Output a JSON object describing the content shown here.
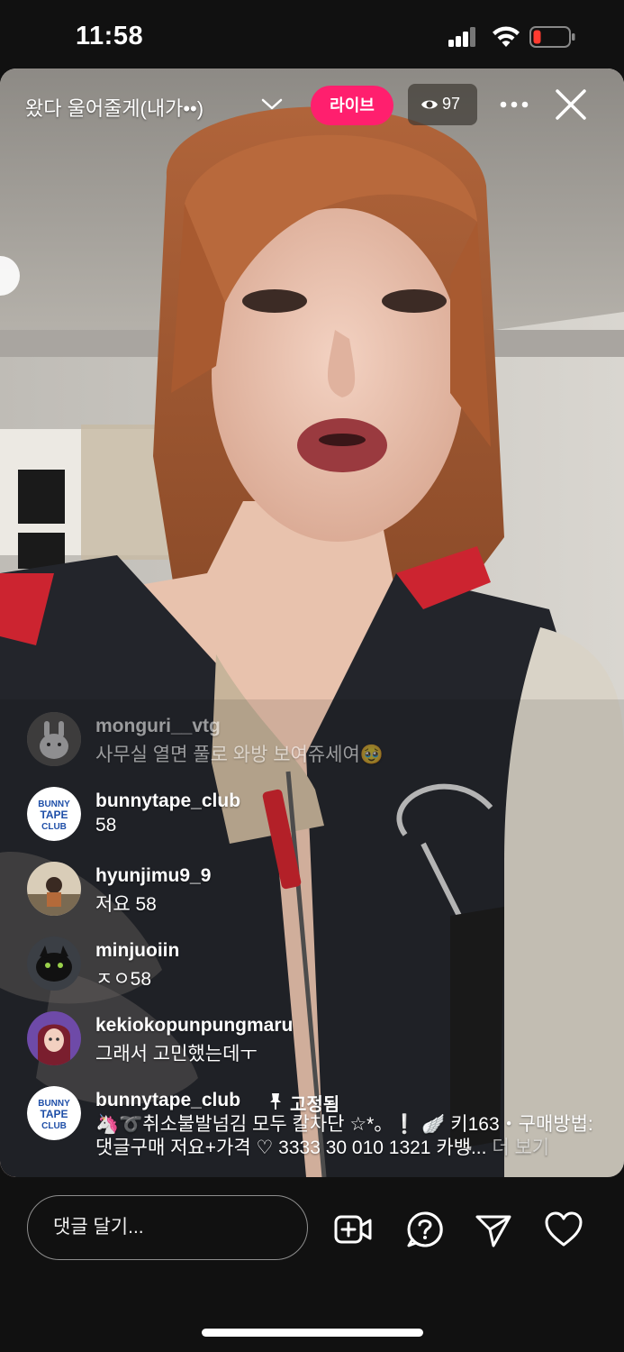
{
  "status_bar": {
    "time": "11:58"
  },
  "live": {
    "title": "왔다 울어줄게(내가••)",
    "badge": "라이브",
    "viewers": "97",
    "accent_color": "#ff1f6e"
  },
  "comments": [
    {
      "username": "monguri__vtg",
      "text": "사무실 열면 풀로 와방 보여쥬세여🥹"
    },
    {
      "username": "bunnytape_club",
      "text": "58"
    },
    {
      "username": "hyunjimu9_9",
      "text": "저요 58"
    },
    {
      "username": "minjuoiin",
      "text": "ㅈㅇ58"
    },
    {
      "username": "kekiokopunpungmaru",
      "text": "그래서 고민했는데ㅜ"
    }
  ],
  "pinned_comment": {
    "username": "bunnytape_club",
    "pin_label": "고정됨",
    "text": "🦄➰취소불발넘김 모두 칼차단 ☆*。❕ 🪽 키163・구매방법: 댓글구매 저요+가격 ♡ 3333 30 010 1321 카뱅...",
    "more_label": "더 보기"
  },
  "bottom_bar": {
    "comment_placeholder": "댓글 달기...",
    "icons": [
      "add-video-icon",
      "question-icon",
      "send-icon",
      "heart-icon"
    ]
  }
}
